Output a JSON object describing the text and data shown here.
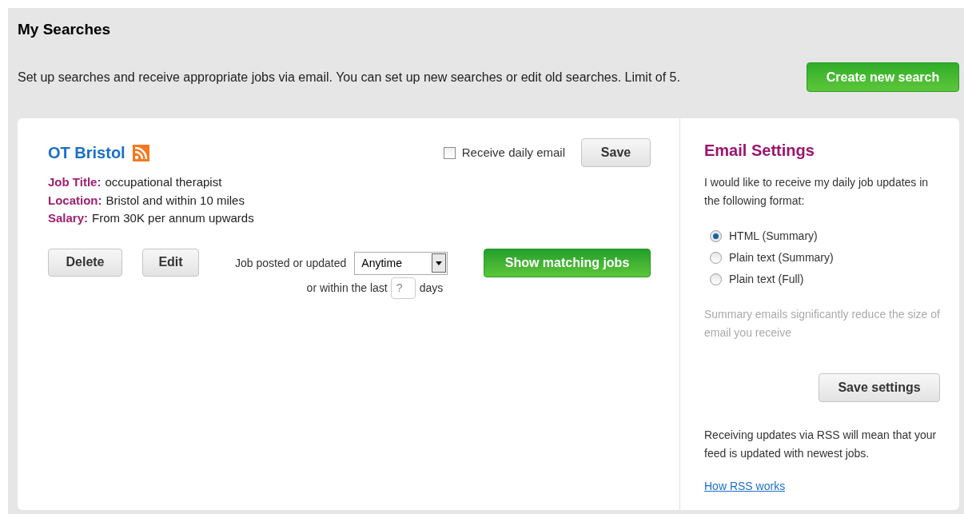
{
  "header": {
    "title": "My Searches",
    "description": "Set up searches and receive appropriate jobs via email. You can set up new searches or edit old searches. Limit of 5.",
    "create_button": "Create new search"
  },
  "search": {
    "name": "OT Bristol",
    "daily_email": {
      "label": "Receive daily email",
      "checked": false
    },
    "save_button": "Save",
    "details": [
      {
        "label": "Job Title:",
        "value": "occupational therapist"
      },
      {
        "label": "Location:",
        "value": "Bristol and within 10 miles"
      },
      {
        "label": "Salary:",
        "value": "From 30K per annum upwards"
      }
    ],
    "delete_button": "Delete",
    "edit_button": "Edit",
    "posted_label": "Job posted or updated",
    "posted_select": "Anytime",
    "within_label": "or within the last",
    "days_placeholder": "?",
    "days_label": "days",
    "show_button": "Show matching jobs"
  },
  "email_settings": {
    "title": "Email Settings",
    "intro": "I would like to receive my daily job updates in the following format:",
    "formats": [
      {
        "label": "HTML (Summary)",
        "selected": true
      },
      {
        "label": "Plain text (Summary)",
        "selected": false
      },
      {
        "label": "Plain text (Full)",
        "selected": false
      }
    ],
    "note": "Summary emails significantly reduce the size of email you receive",
    "save_button": "Save settings",
    "rss_text": "Receiving updates via RSS will mean that your feed is updated with newest jobs.",
    "rss_link": "How RSS works"
  }
}
